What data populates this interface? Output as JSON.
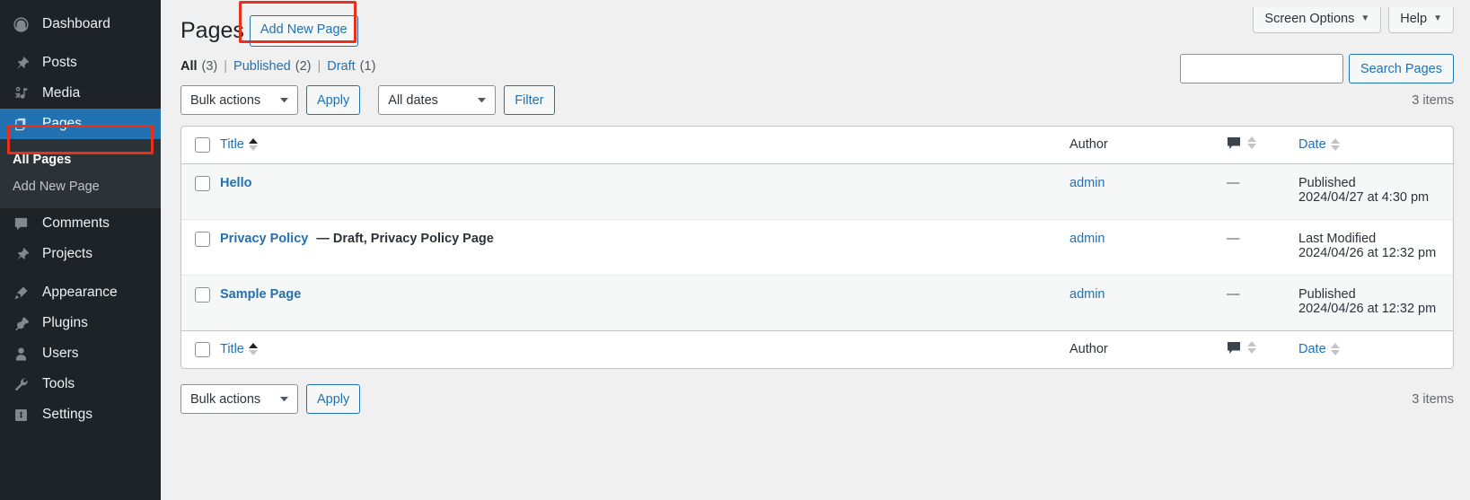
{
  "sidebar": {
    "items": [
      {
        "label": "Dashboard",
        "icon": "dashboard-icon",
        "name": "dashboard"
      },
      {
        "label": "Posts",
        "icon": "pin-icon",
        "name": "posts"
      },
      {
        "label": "Media",
        "icon": "media-icon",
        "name": "media"
      },
      {
        "label": "Pages",
        "icon": "pages-icon",
        "name": "pages",
        "current": true
      },
      {
        "label": "Comments",
        "icon": "comment-icon",
        "name": "comments"
      },
      {
        "label": "Projects",
        "icon": "pin-icon",
        "name": "projects"
      },
      {
        "label": "Appearance",
        "icon": "brush-icon",
        "name": "appearance"
      },
      {
        "label": "Plugins",
        "icon": "plug-icon",
        "name": "plugins"
      },
      {
        "label": "Users",
        "icon": "user-icon",
        "name": "users"
      },
      {
        "label": "Tools",
        "icon": "wrench-icon",
        "name": "tools"
      },
      {
        "label": "Settings",
        "icon": "settings-icon",
        "name": "settings"
      }
    ],
    "submenu": [
      {
        "label": "All Pages",
        "active": true
      },
      {
        "label": "Add New Page",
        "active": false
      }
    ]
  },
  "screen_meta": {
    "screen_options_label": "Screen Options",
    "help_label": "Help",
    "caret": "▼"
  },
  "header": {
    "title": "Pages",
    "add_new_label": "Add New Page"
  },
  "status_links": {
    "all_label": "All",
    "all_count": "(3)",
    "published_label": "Published",
    "published_count": "(2)",
    "draft_label": "Draft",
    "draft_count": "(1)",
    "separator": "|"
  },
  "search": {
    "value": "",
    "placeholder": "",
    "button_label": "Search Pages"
  },
  "tablenav_top": {
    "bulk_actions_label": "Bulk actions",
    "apply_label": "Apply",
    "dates_label": "All dates",
    "filter_label": "Filter",
    "displaying_num": "3 items"
  },
  "tablenav_bottom": {
    "bulk_actions_label": "Bulk actions",
    "apply_label": "Apply",
    "displaying_num": "3 items"
  },
  "table": {
    "columns": {
      "title": "Title",
      "author": "Author",
      "comments_icon": "comment-bubble-icon",
      "date": "Date"
    },
    "rows": [
      {
        "title": "Hello",
        "post_state": "",
        "author": "admin",
        "comments": "—",
        "date_status": "Published",
        "date_value": "2024/04/27 at 4:30 pm",
        "alternate": true
      },
      {
        "title": "Privacy Policy",
        "post_state": "— Draft, Privacy Policy Page",
        "author": "admin",
        "comments": "—",
        "date_status": "Last Modified",
        "date_value": "2024/04/26 at 12:32 pm",
        "alternate": false
      },
      {
        "title": "Sample Page",
        "post_state": "",
        "author": "admin",
        "comments": "—",
        "date_status": "Published",
        "date_value": "2024/04/26 at 12:32 pm",
        "alternate": true
      }
    ]
  },
  "colors": {
    "sidebar_bg": "#1d2327",
    "submenu_bg": "#2c3338",
    "current_menu_bg": "#2271b1",
    "link_blue": "#2271b1",
    "annotation_red": "#e8301a",
    "page_bg": "#f0f0f1",
    "alt_row_bg": "#f6f7f7"
  }
}
